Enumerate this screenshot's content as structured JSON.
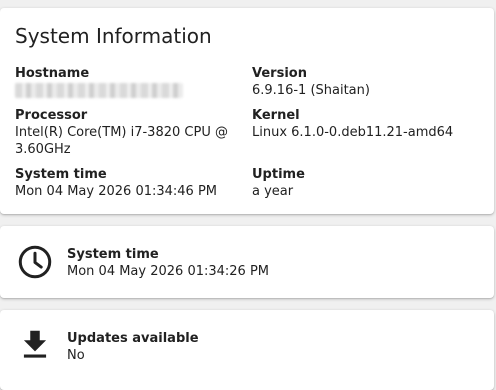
{
  "system_information": {
    "title": "System Information",
    "hostname": {
      "label": "Hostname",
      "value": ""
    },
    "version": {
      "label": "Version",
      "value": "6.9.16-1 (Shaitan)"
    },
    "processor": {
      "label": "Processor",
      "value_line1": "Intel(R) Core(TM) i7-3820 CPU @",
      "value_line2": "3.60GHz"
    },
    "kernel": {
      "label": "Kernel",
      "value": "Linux 6.1.0-0.deb11.21-amd64"
    },
    "system_time": {
      "label": "System time",
      "value": "Mon 04 May 2026 01:34:46 PM"
    },
    "uptime": {
      "label": "Uptime",
      "value": "a year"
    }
  },
  "system_time_card": {
    "icon": "clock-icon",
    "label": "System time",
    "value": "Mon 04 May 2026 01:34:26 PM"
  },
  "updates_card": {
    "icon": "download-icon",
    "label": "Updates available",
    "value": "No"
  }
}
